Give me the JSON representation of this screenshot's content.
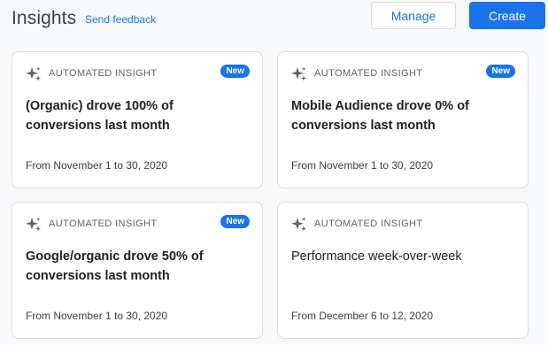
{
  "header": {
    "title": "Insights",
    "feedback_link": "Send feedback",
    "manage_label": "Manage",
    "create_label": "Create"
  },
  "colors": {
    "accent": "#1a73e8",
    "badge_bg": "#1a73e8",
    "page_bg": "#f8f9fa",
    "card_border": "#dadce0"
  },
  "cards": [
    {
      "kind": "AUTOMATED INSIGHT",
      "icon": "sparkle-icon",
      "badge": "New",
      "headline": "(Organic) drove 100% of conversions last month",
      "range": "From November 1 to 30, 2020"
    },
    {
      "kind": "AUTOMATED INSIGHT",
      "icon": "sparkle-icon",
      "badge": "New",
      "headline": "Mobile Audience drove 0% of conversions last month",
      "range": "From November 1 to 30, 2020"
    },
    {
      "kind": "AUTOMATED INSIGHT",
      "icon": "sparkle-icon",
      "badge": "New",
      "headline": "Google/organic drove 50% of conversions last month",
      "range": "From November 1 to 30, 2020"
    },
    {
      "kind": "AUTOMATED INSIGHT",
      "icon": "sparkle-icon",
      "badge": "",
      "headline": "Performance week-over-week",
      "range": "From December 6 to 12, 2020"
    }
  ]
}
